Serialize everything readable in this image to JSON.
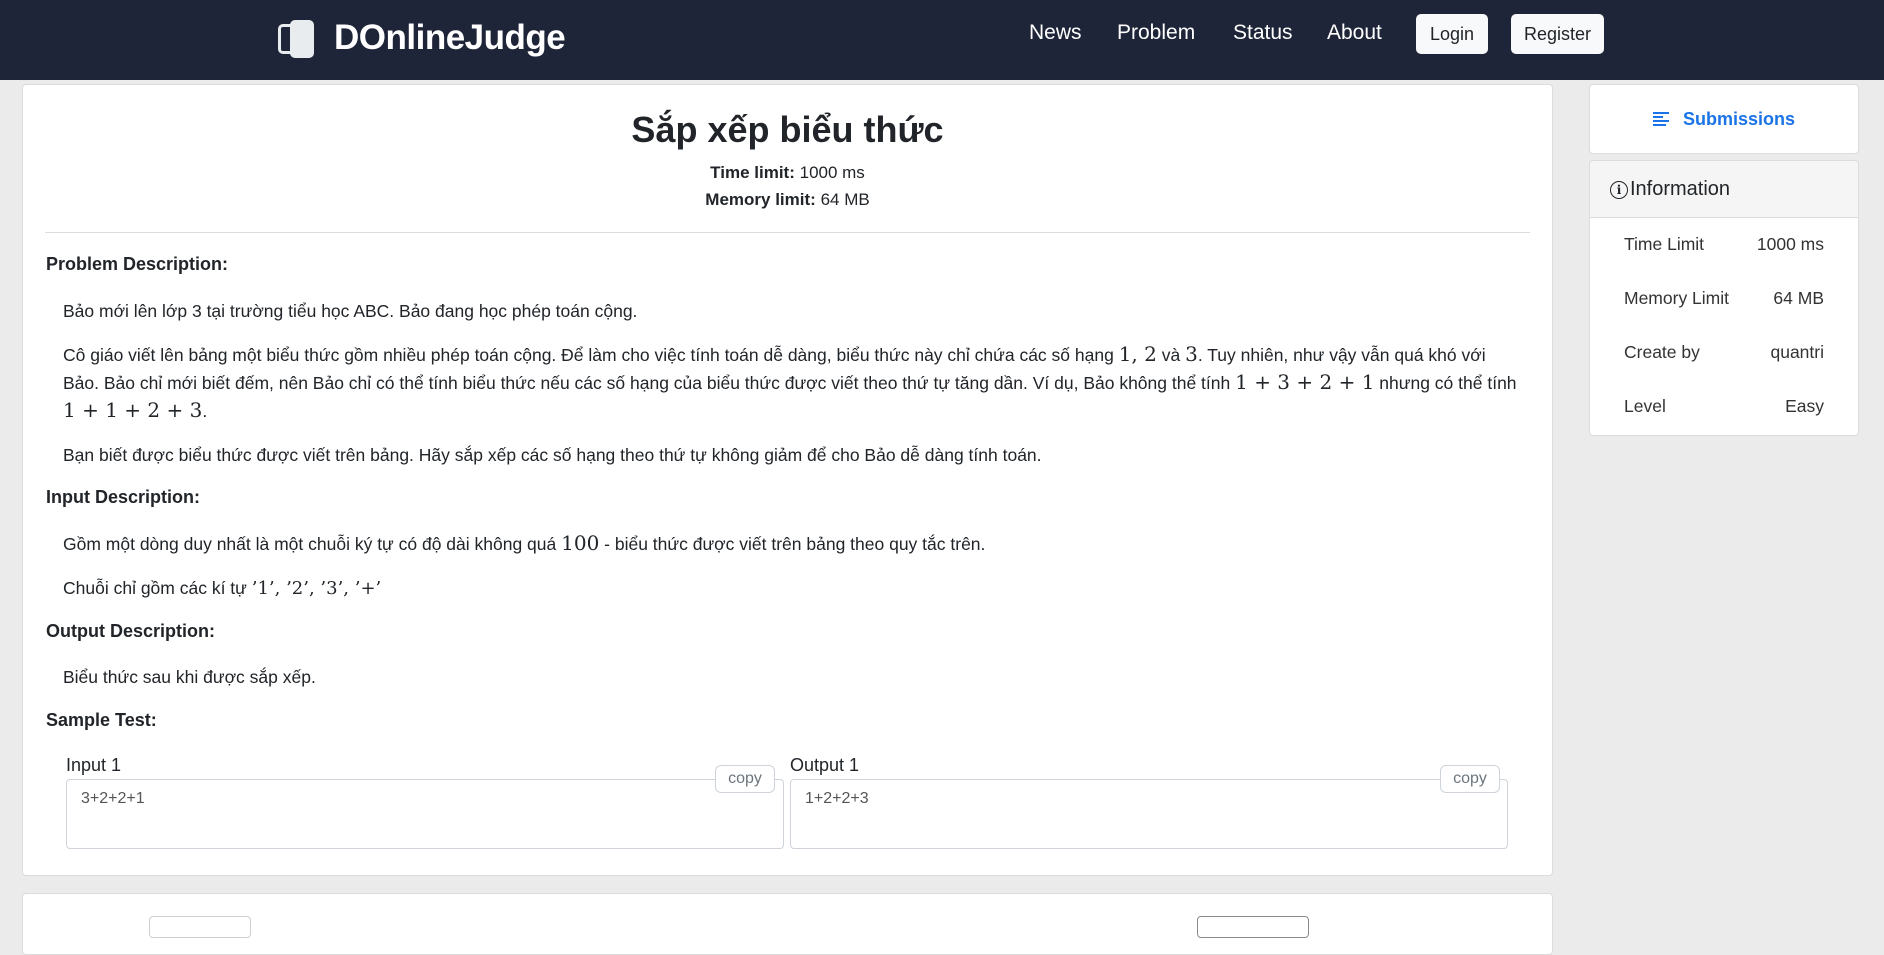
{
  "navbar": {
    "brand": "DOnlineJudge",
    "logo_text": "OJ",
    "links": [
      "News",
      "Problem",
      "Status",
      "About"
    ],
    "login_label": "Login",
    "register_label": "Register",
    "bg_color": "#1f2538"
  },
  "problem": {
    "title": "Sắp xếp biểu thức",
    "time_limit_label": "Time limit:",
    "time_limit_value": "1000 ms",
    "memory_limit_label": "Memory limit:",
    "memory_limit_value": "64 MB",
    "problem_description_heading": "Problem Description:",
    "desc_p1": "Bảo mới lên lớp 3 tại trường tiểu học ABC. Bảo đang học phép toán cộng.",
    "desc_p2_a": "Cô giáo viết lên bảng một biểu thức gồm nhiều phép toán cộng. Để làm cho việc tính toán dễ dàng, biểu thức này chỉ chứa các số hạng ",
    "desc_p2_m1": "1, 2",
    "desc_p2_b": " và ",
    "desc_p2_m2": "3",
    "desc_p2_c": ". Tuy nhiên, như vậy vẫn quá khó với Bảo. Bảo chỉ mới biết đếm, nên Bảo chỉ có thể tính biểu thức nếu các số hạng của biểu thức được viết theo thứ tự tăng dần. Ví dụ, Bảo không thể tính ",
    "desc_p2_m3": "1 + 3 + 2 + 1",
    "desc_p2_d": " nhưng có thể tính ",
    "desc_p2_m4": "1 + 1 + 2 + 3",
    "desc_p2_e": ".",
    "desc_p3": "Bạn biết được biểu thức được viết trên bảng. Hãy sắp xếp các số hạng theo thứ tự không giảm để cho Bảo dễ dàng tính toán.",
    "input_description_heading": "Input Description:",
    "input_p1_a": "Gồm một dòng duy nhất là một chuỗi ký tự có độ dài không quá ",
    "input_p1_m": "100",
    "input_p1_b": " - biểu thức được viết trên bảng theo quy tắc trên.",
    "input_p2_a": "Chuỗi chỉ gồm các kí tự ",
    "input_p2_m": "’1’, ’2’, ’3’, ’+’",
    "output_description_heading": "Output Description:",
    "output_p1": "Biểu thức sau khi được sắp xếp.",
    "sample_test_heading": "Sample Test:",
    "input_label": "Input 1",
    "input_value": "3+2+2+1",
    "output_label": "Output 1",
    "output_value": "1+2+2+3",
    "copy_label": "copy"
  },
  "sidebar": {
    "submissions_label": "Submissions",
    "info_title": "Information",
    "info_rows": [
      {
        "key": "Time Limit",
        "value": "1000 ms"
      },
      {
        "key": "Memory Limit",
        "value": "64 MB"
      },
      {
        "key": "Create by",
        "value": "quantri"
      },
      {
        "key": "Level",
        "value": "Easy"
      }
    ],
    "accent_color": "#1a73e8"
  }
}
